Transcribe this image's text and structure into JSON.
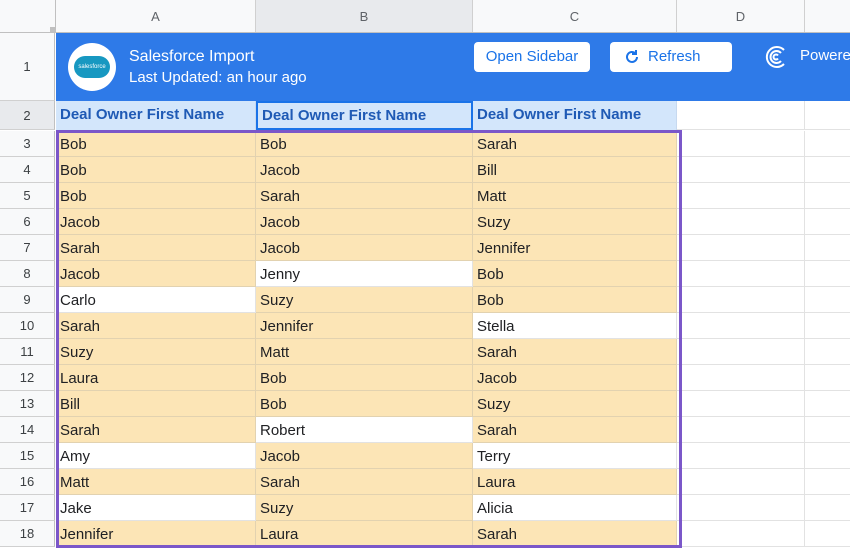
{
  "columns": [
    "A",
    "B",
    "C",
    "D"
  ],
  "banner": {
    "title": "Salesforce Import",
    "subtitle": "Last Updated: an hour ago",
    "logo_text": "salesforce",
    "open_sidebar_label": "Open Sidebar",
    "refresh_label": "Refresh",
    "powered_label": "Powere",
    "color": "#2e7ae8"
  },
  "header_row": {
    "row_number": "2",
    "cells": [
      "Deal Owner First Name",
      "Deal Owner First Name",
      "Deal Owner First Name"
    ]
  },
  "rows": [
    {
      "n": "3",
      "cells": [
        "Bob",
        "Bob",
        "Sarah"
      ],
      "hl": [
        1,
        1,
        1
      ]
    },
    {
      "n": "4",
      "cells": [
        "Bob",
        "Jacob",
        "Bill"
      ],
      "hl": [
        1,
        1,
        1
      ]
    },
    {
      "n": "5",
      "cells": [
        "Bob",
        "Sarah",
        "Matt"
      ],
      "hl": [
        1,
        1,
        1
      ]
    },
    {
      "n": "6",
      "cells": [
        "Jacob",
        "Jacob",
        "Suzy"
      ],
      "hl": [
        1,
        1,
        1
      ]
    },
    {
      "n": "7",
      "cells": [
        "Sarah",
        "Jacob",
        "Jennifer"
      ],
      "hl": [
        1,
        1,
        1
      ]
    },
    {
      "n": "8",
      "cells": [
        "Jacob",
        "Jenny",
        "Bob"
      ],
      "hl": [
        1,
        0,
        1
      ]
    },
    {
      "n": "9",
      "cells": [
        "Carlo",
        "Suzy",
        "Bob"
      ],
      "hl": [
        0,
        1,
        1
      ]
    },
    {
      "n": "10",
      "cells": [
        "Sarah",
        "Jennifer",
        "Stella"
      ],
      "hl": [
        1,
        1,
        0
      ]
    },
    {
      "n": "11",
      "cells": [
        "Suzy",
        "Matt",
        "Sarah"
      ],
      "hl": [
        1,
        1,
        1
      ]
    },
    {
      "n": "12",
      "cells": [
        "Laura",
        "Bob",
        "Jacob"
      ],
      "hl": [
        1,
        1,
        1
      ]
    },
    {
      "n": "13",
      "cells": [
        "Bill",
        "Bob",
        "Suzy"
      ],
      "hl": [
        1,
        1,
        1
      ]
    },
    {
      "n": "14",
      "cells": [
        "Sarah",
        "Robert",
        "Sarah"
      ],
      "hl": [
        1,
        0,
        1
      ]
    },
    {
      "n": "15",
      "cells": [
        "Amy",
        "Jacob",
        "Terry"
      ],
      "hl": [
        0,
        1,
        0
      ]
    },
    {
      "n": "16",
      "cells": [
        "Matt",
        "Sarah",
        "Laura"
      ],
      "hl": [
        1,
        1,
        1
      ]
    },
    {
      "n": "17",
      "cells": [
        "Jake",
        "Suzy",
        "Alicia"
      ],
      "hl": [
        0,
        1,
        0
      ]
    },
    {
      "n": "18",
      "cells": [
        "Jennifer",
        "Laura",
        "Sarah"
      ],
      "hl": [
        1,
        1,
        1
      ]
    }
  ],
  "row1_number": "1",
  "colors": {
    "highlight": "#fce5b6",
    "header_fill": "#d3e6fb",
    "selection_border": "#7b57c9"
  },
  "icons": [
    "salesforce-logo",
    "refresh-icon",
    "powered-by-icon"
  ]
}
